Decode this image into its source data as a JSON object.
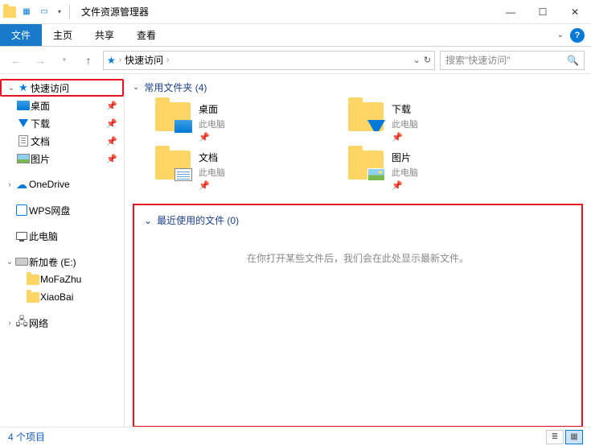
{
  "title": "文件资源管理器",
  "ribbon": {
    "file": "文件",
    "home": "主页",
    "share": "共享",
    "view": "查看"
  },
  "address": {
    "root": "快速访问"
  },
  "search": {
    "placeholder": "搜索\"快速访问\""
  },
  "sidebar": {
    "quick_access": "快速访问",
    "desktop": "桌面",
    "downloads": "下载",
    "documents": "文档",
    "pictures": "图片",
    "onedrive": "OneDrive",
    "wps": "WPS网盘",
    "this_pc": "此电脑",
    "volume": "新加卷 (E:)",
    "folder1": "MoFaZhu",
    "folder2": "XiaoBai",
    "network": "网络"
  },
  "content": {
    "frequent_header": "常用文件夹 (4)",
    "tiles": [
      {
        "name": "桌面",
        "sub": "此电脑",
        "overlay": "ov-desktop"
      },
      {
        "name": "下载",
        "sub": "此电脑",
        "overlay": "ov-download"
      },
      {
        "name": "文档",
        "sub": "此电脑",
        "overlay": "ov-doc"
      },
      {
        "name": "图片",
        "sub": "此电脑",
        "overlay": "ov-pic"
      }
    ],
    "recent_header": "最近使用的文件 (0)",
    "recent_empty": "在你打开某些文件后，我们会在此处显示最新文件。"
  },
  "statusbar": {
    "count": "4 个项目"
  }
}
